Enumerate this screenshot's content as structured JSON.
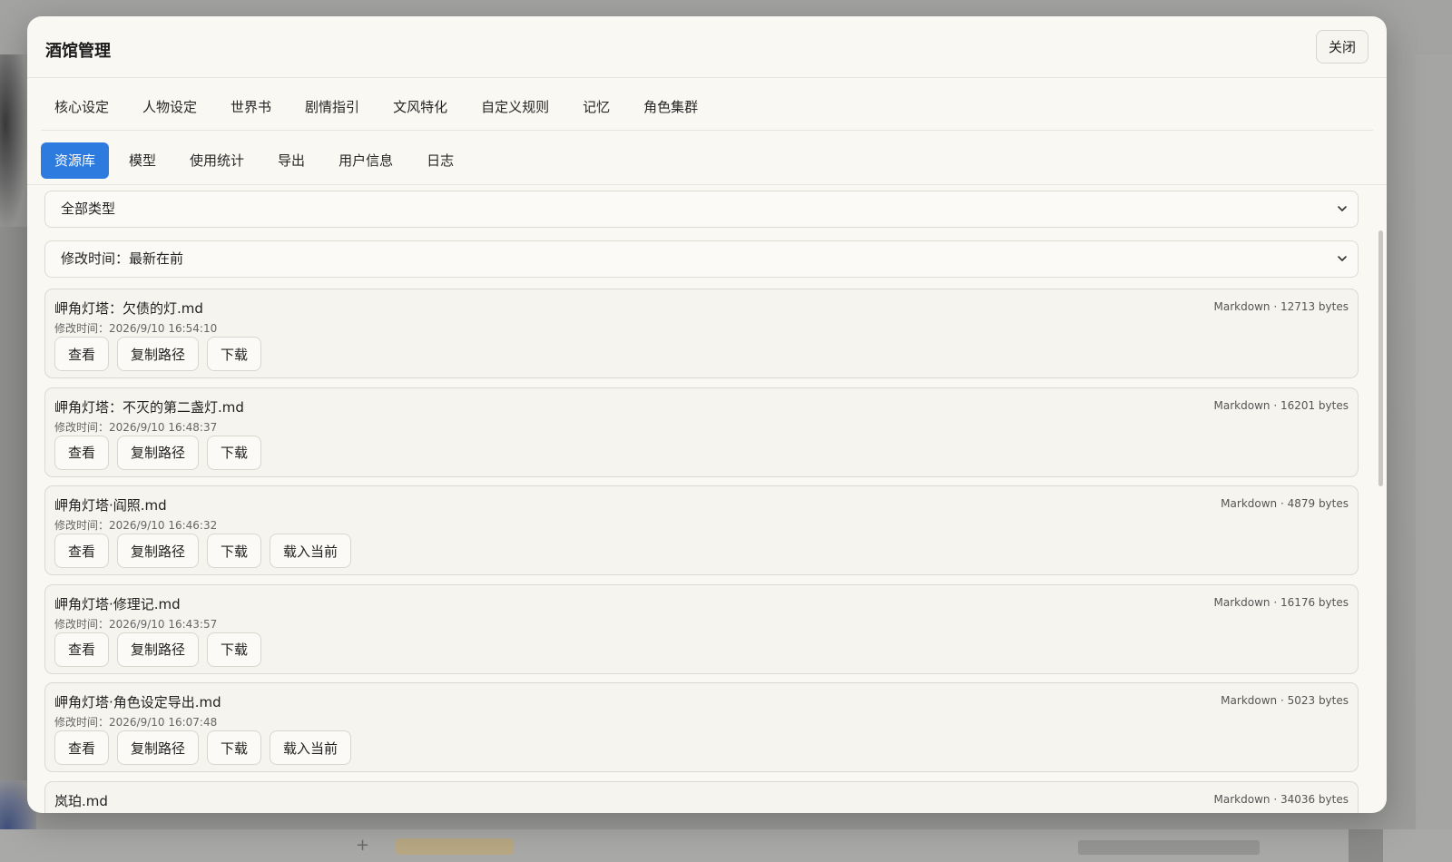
{
  "modal": {
    "title": "酒馆管理",
    "close_label": "关闭"
  },
  "tabs_primary": [
    {
      "label": "核心设定"
    },
    {
      "label": "人物设定"
    },
    {
      "label": "世界书"
    },
    {
      "label": "剧情指引"
    },
    {
      "label": "文风特化"
    },
    {
      "label": "自定义规则"
    },
    {
      "label": "记忆"
    },
    {
      "label": "角色集群"
    }
  ],
  "tabs_secondary": [
    {
      "label": "资源库",
      "active": true
    },
    {
      "label": "模型"
    },
    {
      "label": "使用统计"
    },
    {
      "label": "导出"
    },
    {
      "label": "用户信息"
    },
    {
      "label": "日志"
    }
  ],
  "filters": {
    "type_select": "全部类型",
    "sort_select": "修改时间：最新在前"
  },
  "files": [
    {
      "name": "岬角灯塔：欠债的灯.md",
      "meta": "Markdown · 12713 bytes",
      "modified": "修改时间：2026/9/10 16:54:10",
      "actions": [
        "查看",
        "复制路径",
        "下载"
      ]
    },
    {
      "name": "岬角灯塔：不灭的第二盏灯.md",
      "meta": "Markdown · 16201 bytes",
      "modified": "修改时间：2026/9/10 16:48:37",
      "actions": [
        "查看",
        "复制路径",
        "下载"
      ]
    },
    {
      "name": "岬角灯塔·阎照.md",
      "meta": "Markdown · 4879 bytes",
      "modified": "修改时间：2026/9/10 16:46:32",
      "actions": [
        "查看",
        "复制路径",
        "下载",
        "载入当前"
      ]
    },
    {
      "name": "岬角灯塔·修理记.md",
      "meta": "Markdown · 16176 bytes",
      "modified": "修改时间：2026/9/10 16:43:57",
      "actions": [
        "查看",
        "复制路径",
        "下载"
      ]
    },
    {
      "name": "岬角灯塔·角色设定导出.md",
      "meta": "Markdown · 5023 bytes",
      "modified": "修改时间：2026/9/10 16:07:48",
      "actions": [
        "查看",
        "复制路径",
        "下载",
        "载入当前"
      ]
    },
    {
      "name": "岚珀.md",
      "meta": "Markdown · 34036 bytes",
      "modified": "",
      "actions": []
    }
  ],
  "colors": {
    "accent": "#2e7be0",
    "modal_bg": "#faf8f3",
    "card_bg": "#f6f4ee"
  }
}
